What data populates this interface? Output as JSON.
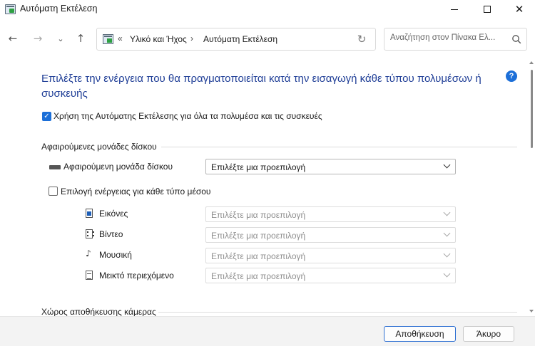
{
  "window": {
    "title": "Αυτόματη Εκτέλεση",
    "icon": "control-panel-icon",
    "controls": {
      "minimize": "minimize-icon",
      "maximize": "maximize-icon",
      "close": "✕"
    }
  },
  "navigation": {
    "back": "←",
    "forward": "→",
    "recent": "⌄",
    "up": "↑",
    "address_overflow": "«",
    "breadcrumb": [
      "Υλικό και Ήχος",
      "Αυτόματη Εκτέλεση"
    ],
    "breadcrumb_separator": "›",
    "refresh": "↻",
    "search_placeholder": "Αναζήτηση στον Πίνακα Ελ..."
  },
  "main": {
    "heading": "Επιλέξτε την ενέργεια που θα πραγματοποιείται κατά την εισαγωγή κάθε τύπου πολυμέσων ή συσκευής",
    "help": "?",
    "use_autoplay": {
      "label": "Χρήση της Αυτόματης Εκτέλεσης για όλα τα πολυμέσα και τις συσκευές",
      "checked": true
    },
    "removable_section": {
      "title": "Αφαιρούμενες μονάδες δίσκου",
      "drive": {
        "label": "Αφαιρούμενη μονάδα δίσκου",
        "value": "Επιλέξτε μια προεπιλογή",
        "icon": "drive-icon"
      },
      "per_media": {
        "label": "Επιλογή ενέργειας για κάθε τύπο μέσου",
        "checked": false
      },
      "media": [
        {
          "label": "Εικόνες",
          "value": "Επιλέξτε μια προεπιλογή",
          "icon": "pictures-icon",
          "enabled": false
        },
        {
          "label": "Βίντεο",
          "value": "Επιλέξτε μια προεπιλογή",
          "icon": "video-icon",
          "enabled": false
        },
        {
          "label": "Μουσική",
          "value": "Επιλέξτε μια προεπιλογή",
          "icon": "music-icon",
          "enabled": false
        },
        {
          "label": "Μεικτό περιεχόμενο",
          "value": "Επιλέξτε μια προεπιλογή",
          "icon": "mixed-content-icon",
          "enabled": false
        }
      ]
    },
    "camera_section": {
      "title": "Χώρος αποθήκευσης κάμερας"
    }
  },
  "footer": {
    "save_label": "Αποθήκευση",
    "cancel_label": "Άκυρο"
  },
  "colors": {
    "accent": "#1c6fd8",
    "heading": "#1e3d96",
    "footer_bg": "#f3f3f3"
  }
}
